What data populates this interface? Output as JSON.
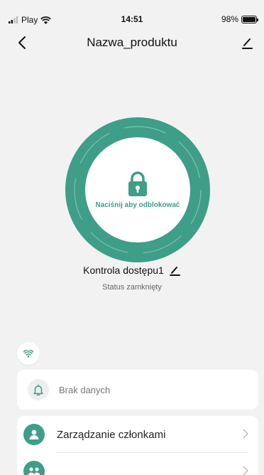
{
  "status_bar": {
    "carrier": "Play",
    "time": "14:51",
    "battery_text": "98%",
    "battery_level": 0.98
  },
  "nav": {
    "title": "Nazwa_produktu"
  },
  "lock": {
    "label": "Naciśnij aby odblokować"
  },
  "device": {
    "name": "Kontrola dostępu1",
    "status": "Status zamknięty"
  },
  "log_card": {
    "label": "Brak danych"
  },
  "menu": {
    "items": [
      {
        "label": "Zarządzanie członkami",
        "icon": "user-icon"
      },
      {
        "label": "",
        "icon": "users-icon"
      }
    ]
  },
  "icons": [
    "signal-icon",
    "wifi-icon",
    "battery-icon",
    "back-icon",
    "edit-icon",
    "lock-icon",
    "wifi-chip-icon",
    "bell-icon",
    "user-icon",
    "users-icon",
    "chevron-right-icon"
  ],
  "colors": {
    "accent": "#3e9e87",
    "background": "#f2f2f2",
    "card": "#ffffff"
  }
}
